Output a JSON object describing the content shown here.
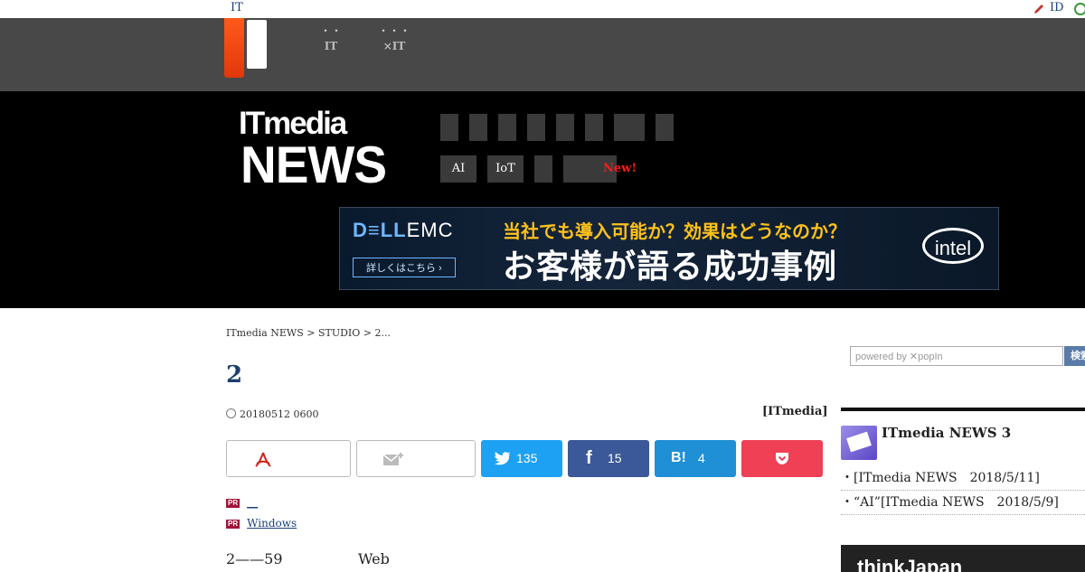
{
  "topbar": {
    "it_link": "IT",
    "id_link": "ID"
  },
  "header_nav": [
    {
      "line1": "・・",
      "line2": "IT"
    },
    {
      "line1": "・・・",
      "line2": "×IT"
    }
  ],
  "brand": {
    "it": "IT",
    "media": "media",
    "news": "NEWS"
  },
  "subnav": {
    "ai": "AI",
    "iot": "IoT",
    "new": "New!"
  },
  "banner": {
    "dell": "D≡LL",
    "emc": "EMC",
    "detail": "詳しくはこちら ›",
    "line1": "当社でも導入可能か？効果はどうなのか？",
    "line2": "お客様が語る成功事例",
    "intel": "intel"
  },
  "breadcrumb": "ITmedia NEWS > STUDIO > 2...",
  "article": {
    "title": "2",
    "date": "20180512 0600",
    "source": "[ITmedia]",
    "body_start": "2——59",
    "body_mid": "Web"
  },
  "share": {
    "twitter_count": "135",
    "facebook_count": "15",
    "hatena_label": "B!",
    "hatena_count": "4"
  },
  "pr_links": [
    {
      "tag": "PR",
      "text": "__"
    },
    {
      "tag": "PR",
      "text": "Windows"
    }
  ],
  "sidebar": {
    "search_placeholder": "powered by ✕popIn",
    "search_button": "検索",
    "ranking_title": "ITmedia NEWS 3",
    "items": [
      "・[ITmedia NEWS　2018/5/11]",
      "・“AI”[ITmedia NEWS　2018/5/9]"
    ],
    "ad_text": "thinkJapan"
  },
  "colors": {
    "accent_orange": "#ff5a1a",
    "twitter": "#1da1f2",
    "facebook": "#3b5998",
    "hatena": "#1f8fd6",
    "pocket": "#ef4056",
    "title_blue": "#1a3f6e"
  }
}
